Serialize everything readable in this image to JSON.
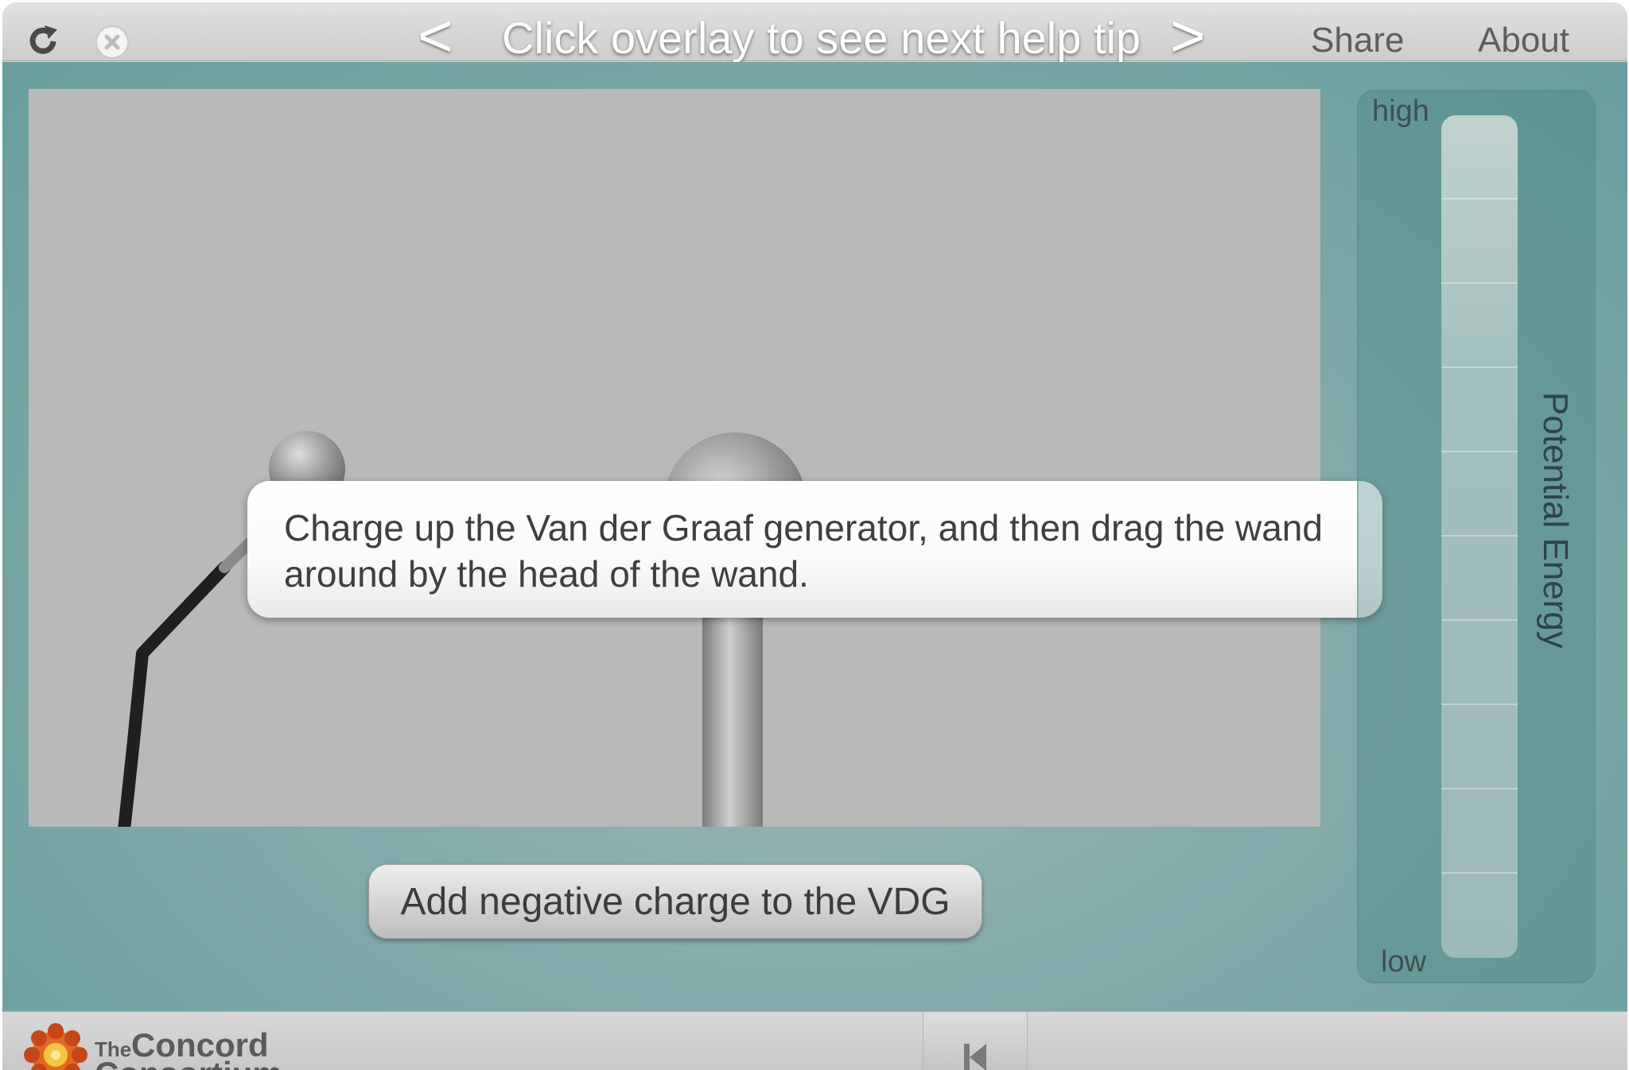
{
  "topbar": {
    "reload_icon": "reload-icon",
    "close_icon": "close-icon",
    "prev_arrow": "<",
    "help_tip": "Click overlay to see next help tip",
    "next_arrow": ">",
    "share": "Share",
    "about": "About"
  },
  "simulation": {
    "tooltip_text": "Charge up the Van der Graaf generator, and then drag the wand around by the head of the wand.",
    "add_charge_button": "Add negative charge to the VDG"
  },
  "energy_meter": {
    "title": "Potential Energy",
    "high_label": "high",
    "low_label": "low",
    "level": 0
  },
  "footer": {
    "logo_the": "The",
    "logo_concord": "Concord",
    "logo_consortium": "Consortium",
    "rewind_icon": "rewind-to-start-icon"
  },
  "colors": {
    "teal_bg": "#699e9e",
    "sim_bg": "#b9b9b9",
    "tooltip_bg": "#ffffff",
    "logo_orange": "#e06a20"
  }
}
